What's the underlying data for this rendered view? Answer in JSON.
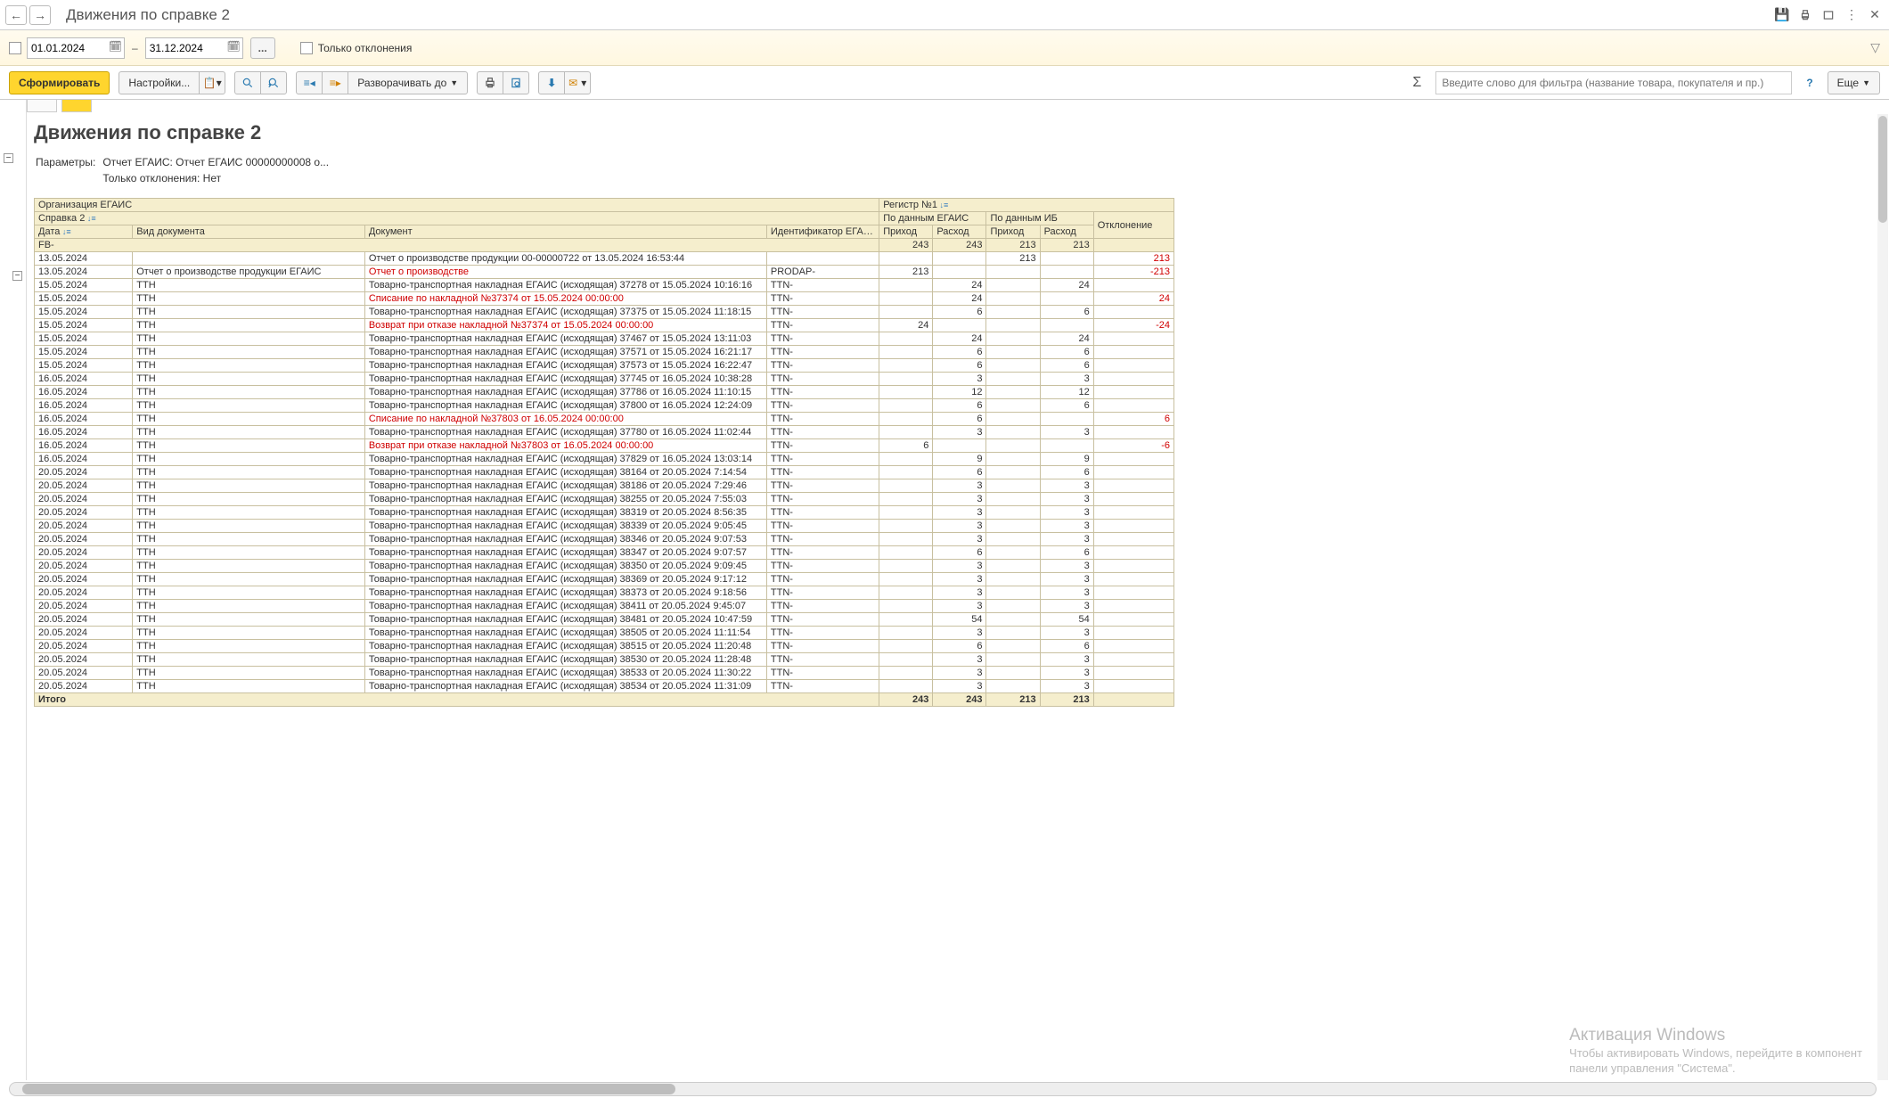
{
  "title": "Движения по справке 2",
  "filter": {
    "date_from": "01.01.2024",
    "date_to": "31.12.2024",
    "dash": "–",
    "dots": "...",
    "only_deviations_label": "Только отклонения"
  },
  "toolbar": {
    "form": "Сформировать",
    "settings": "Настройки...",
    "expand": "Разворачивать до",
    "more": "Еще",
    "search_placeholder": "Введите слово для фильтра (название товара, покупателя и пр.)",
    "help": "?"
  },
  "report": {
    "title": "Движения по справке 2",
    "params_label": "Параметры:",
    "param1": "Отчет ЕГАИС: Отчет ЕГАИС 00000000008 о...",
    "param2": "Только отклонения: Нет"
  },
  "headers": {
    "org": "Организация ЕГАИС",
    "reg": "Регистр №1",
    "spravka": "Справка 2",
    "egais_data": "По данным ЕГАИС",
    "ib_data": "По данным ИБ",
    "deviation": "Отклонение",
    "date": "Дата",
    "doc_type": "Вид документа",
    "document": "Документ",
    "egais_id": "Идентификатор ЕГАИС",
    "income": "Приход",
    "expense": "Расход"
  },
  "group": {
    "label": "FB-",
    "e_in": 243,
    "e_out": 243,
    "i_in": 213,
    "i_out": 213
  },
  "rows": [
    {
      "date": "13.05.2024",
      "type": "",
      "doc": "Отчет о производстве продукции 00-00000722 от 13.05.2024 16:53:44",
      "id": "",
      "e_in": "",
      "e_out": "",
      "i_in": 213,
      "i_out": "",
      "dev": 213,
      "red_dev": true
    },
    {
      "date": "13.05.2024",
      "type": "Отчет о производстве продукции ЕГАИС",
      "doc": "Отчет о производстве",
      "id": "PRODAP-",
      "e_in": 213,
      "e_out": "",
      "i_in": "",
      "i_out": "",
      "dev": -213,
      "red_dev": true,
      "red_doc": true
    },
    {
      "date": "15.05.2024",
      "type": "ТТН",
      "doc": "Товарно-транспортная накладная ЕГАИС (исходящая) 37278 от 15.05.2024 10:16:16",
      "id": "TTN-",
      "e_in": "",
      "e_out": 24,
      "i_in": "",
      "i_out": 24,
      "dev": ""
    },
    {
      "date": "15.05.2024",
      "type": "ТТН",
      "doc": "Списание по накладной №37374 от 15.05.2024 00:00:00",
      "id": "TTN-",
      "e_in": "",
      "e_out": 24,
      "i_in": "",
      "i_out": "",
      "dev": 24,
      "red_dev": true,
      "red_doc": true
    },
    {
      "date": "15.05.2024",
      "type": "ТТН",
      "doc": "Товарно-транспортная накладная ЕГАИС (исходящая) 37375 от 15.05.2024 11:18:15",
      "id": "TTN-",
      "e_in": "",
      "e_out": 6,
      "i_in": "",
      "i_out": 6,
      "dev": ""
    },
    {
      "date": "15.05.2024",
      "type": "ТТН",
      "doc": "Возврат при отказе накладной №37374 от 15.05.2024 00:00:00",
      "id": "TTN-",
      "e_in": 24,
      "e_out": "",
      "i_in": "",
      "i_out": "",
      "dev": -24,
      "red_dev": true,
      "red_doc": true
    },
    {
      "date": "15.05.2024",
      "type": "ТТН",
      "doc": "Товарно-транспортная накладная ЕГАИС (исходящая) 37467 от 15.05.2024 13:11:03",
      "id": "TTN-",
      "e_in": "",
      "e_out": 24,
      "i_in": "",
      "i_out": 24,
      "dev": ""
    },
    {
      "date": "15.05.2024",
      "type": "ТТН",
      "doc": "Товарно-транспортная накладная ЕГАИС (исходящая) 37571 от 15.05.2024 16:21:17",
      "id": "TTN-",
      "e_in": "",
      "e_out": 6,
      "i_in": "",
      "i_out": 6,
      "dev": ""
    },
    {
      "date": "15.05.2024",
      "type": "ТТН",
      "doc": "Товарно-транспортная накладная ЕГАИС (исходящая) 37573 от 15.05.2024 16:22:47",
      "id": "TTN-",
      "e_in": "",
      "e_out": 6,
      "i_in": "",
      "i_out": 6,
      "dev": ""
    },
    {
      "date": "16.05.2024",
      "type": "ТТН",
      "doc": "Товарно-транспортная накладная ЕГАИС (исходящая) 37745 от 16.05.2024 10:38:28",
      "id": "TTN-",
      "e_in": "",
      "e_out": 3,
      "i_in": "",
      "i_out": 3,
      "dev": ""
    },
    {
      "date": "16.05.2024",
      "type": "ТТН",
      "doc": "Товарно-транспортная накладная ЕГАИС (исходящая) 37786 от 16.05.2024 11:10:15",
      "id": "TTN-",
      "e_in": "",
      "e_out": 12,
      "i_in": "",
      "i_out": 12,
      "dev": ""
    },
    {
      "date": "16.05.2024",
      "type": "ТТН",
      "doc": "Товарно-транспортная накладная ЕГАИС (исходящая) 37800 от 16.05.2024 12:24:09",
      "id": "TTN-",
      "e_in": "",
      "e_out": 6,
      "i_in": "",
      "i_out": 6,
      "dev": ""
    },
    {
      "date": "16.05.2024",
      "type": "ТТН",
      "doc": "Списание по накладной №37803 от 16.05.2024 00:00:00",
      "id": "TTN-",
      "e_in": "",
      "e_out": 6,
      "i_in": "",
      "i_out": "",
      "dev": 6,
      "red_dev": true,
      "red_doc": true
    },
    {
      "date": "16.05.2024",
      "type": "ТТН",
      "doc": "Товарно-транспортная накладная ЕГАИС (исходящая) 37780 от 16.05.2024 11:02:44",
      "id": "TTN-",
      "e_in": "",
      "e_out": 3,
      "i_in": "",
      "i_out": 3,
      "dev": ""
    },
    {
      "date": "16.05.2024",
      "type": "ТТН",
      "doc": "Возврат при отказе накладной №37803 от 16.05.2024 00:00:00",
      "id": "TTN-",
      "e_in": 6,
      "e_out": "",
      "i_in": "",
      "i_out": "",
      "dev": -6,
      "red_dev": true,
      "red_doc": true
    },
    {
      "date": "16.05.2024",
      "type": "ТТН",
      "doc": "Товарно-транспортная накладная ЕГАИС (исходящая) 37829 от 16.05.2024 13:03:14",
      "id": "TTN-",
      "e_in": "",
      "e_out": 9,
      "i_in": "",
      "i_out": 9,
      "dev": ""
    },
    {
      "date": "20.05.2024",
      "type": "ТТН",
      "doc": "Товарно-транспортная накладная ЕГАИС (исходящая) 38164 от 20.05.2024 7:14:54",
      "id": "TTN-",
      "e_in": "",
      "e_out": 6,
      "i_in": "",
      "i_out": 6,
      "dev": ""
    },
    {
      "date": "20.05.2024",
      "type": "ТТН",
      "doc": "Товарно-транспортная накладная ЕГАИС (исходящая) 38186 от 20.05.2024 7:29:46",
      "id": "TTN-",
      "e_in": "",
      "e_out": 3,
      "i_in": "",
      "i_out": 3,
      "dev": ""
    },
    {
      "date": "20.05.2024",
      "type": "ТТН",
      "doc": "Товарно-транспортная накладная ЕГАИС (исходящая) 38255 от 20.05.2024 7:55:03",
      "id": "TTN-",
      "e_in": "",
      "e_out": 3,
      "i_in": "",
      "i_out": 3,
      "dev": ""
    },
    {
      "date": "20.05.2024",
      "type": "ТТН",
      "doc": "Товарно-транспортная накладная ЕГАИС (исходящая) 38319 от 20.05.2024 8:56:35",
      "id": "TTN-",
      "e_in": "",
      "e_out": 3,
      "i_in": "",
      "i_out": 3,
      "dev": ""
    },
    {
      "date": "20.05.2024",
      "type": "ТТН",
      "doc": "Товарно-транспортная накладная ЕГАИС (исходящая) 38339 от 20.05.2024 9:05:45",
      "id": "TTN-",
      "e_in": "",
      "e_out": 3,
      "i_in": "",
      "i_out": 3,
      "dev": ""
    },
    {
      "date": "20.05.2024",
      "type": "ТТН",
      "doc": "Товарно-транспортная накладная ЕГАИС (исходящая) 38346 от 20.05.2024 9:07:53",
      "id": "TTN-",
      "e_in": "",
      "e_out": 3,
      "i_in": "",
      "i_out": 3,
      "dev": ""
    },
    {
      "date": "20.05.2024",
      "type": "ТТН",
      "doc": "Товарно-транспортная накладная ЕГАИС (исходящая) 38347 от 20.05.2024 9:07:57",
      "id": "TTN-",
      "e_in": "",
      "e_out": 6,
      "i_in": "",
      "i_out": 6,
      "dev": ""
    },
    {
      "date": "20.05.2024",
      "type": "ТТН",
      "doc": "Товарно-транспортная накладная ЕГАИС (исходящая) 38350 от 20.05.2024 9:09:45",
      "id": "TTN-",
      "e_in": "",
      "e_out": 3,
      "i_in": "",
      "i_out": 3,
      "dev": ""
    },
    {
      "date": "20.05.2024",
      "type": "ТТН",
      "doc": "Товарно-транспортная накладная ЕГАИС (исходящая) 38369 от 20.05.2024 9:17:12",
      "id": "TTN-",
      "e_in": "",
      "e_out": 3,
      "i_in": "",
      "i_out": 3,
      "dev": ""
    },
    {
      "date": "20.05.2024",
      "type": "ТТН",
      "doc": "Товарно-транспортная накладная ЕГАИС (исходящая) 38373 от 20.05.2024 9:18:56",
      "id": "TTN-",
      "e_in": "",
      "e_out": 3,
      "i_in": "",
      "i_out": 3,
      "dev": ""
    },
    {
      "date": "20.05.2024",
      "type": "ТТН",
      "doc": "Товарно-транспортная накладная ЕГАИС (исходящая) 38411 от 20.05.2024 9:45:07",
      "id": "TTN-",
      "e_in": "",
      "e_out": 3,
      "i_in": "",
      "i_out": 3,
      "dev": ""
    },
    {
      "date": "20.05.2024",
      "type": "ТТН",
      "doc": "Товарно-транспортная накладная ЕГАИС (исходящая) 38481 от 20.05.2024 10:47:59",
      "id": "TTN-",
      "e_in": "",
      "e_out": 54,
      "i_in": "",
      "i_out": 54,
      "dev": ""
    },
    {
      "date": "20.05.2024",
      "type": "ТТН",
      "doc": "Товарно-транспортная накладная ЕГАИС (исходящая) 38505 от 20.05.2024 11:11:54",
      "id": "TTN-",
      "e_in": "",
      "e_out": 3,
      "i_in": "",
      "i_out": 3,
      "dev": ""
    },
    {
      "date": "20.05.2024",
      "type": "ТТН",
      "doc": "Товарно-транспортная накладная ЕГАИС (исходящая) 38515 от 20.05.2024 11:20:48",
      "id": "TTN-",
      "e_in": "",
      "e_out": 6,
      "i_in": "",
      "i_out": 6,
      "dev": ""
    },
    {
      "date": "20.05.2024",
      "type": "ТТН",
      "doc": "Товарно-транспортная накладная ЕГАИС (исходящая) 38530 от 20.05.2024 11:28:48",
      "id": "TTN-",
      "e_in": "",
      "e_out": 3,
      "i_in": "",
      "i_out": 3,
      "dev": ""
    },
    {
      "date": "20.05.2024",
      "type": "ТТН",
      "doc": "Товарно-транспортная накладная ЕГАИС (исходящая) 38533 от 20.05.2024 11:30:22",
      "id": "TTN-",
      "e_in": "",
      "e_out": 3,
      "i_in": "",
      "i_out": 3,
      "dev": ""
    },
    {
      "date": "20.05.2024",
      "type": "ТТН",
      "doc": "Товарно-транспортная накладная ЕГАИС (исходящая) 38534 от 20.05.2024 11:31:09",
      "id": "TTN-",
      "e_in": "",
      "e_out": 3,
      "i_in": "",
      "i_out": 3,
      "dev": ""
    }
  ],
  "totals": {
    "label": "Итого",
    "e_in": 243,
    "e_out": 243,
    "i_in": 213,
    "i_out": 213
  },
  "watermark": {
    "l1": "Активация Windows",
    "l2": "Чтобы активировать Windows, перейдите в компонент",
    "l3": "панели управления \"Система\"."
  }
}
